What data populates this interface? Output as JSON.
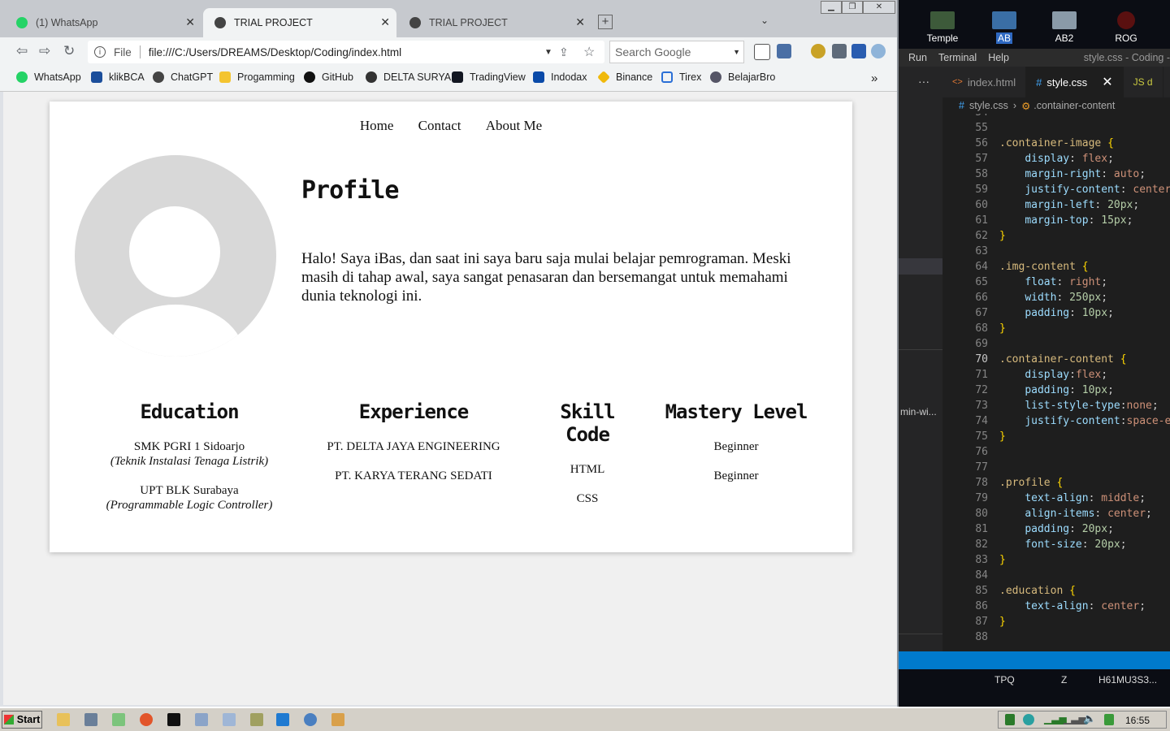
{
  "browser": {
    "tabs": [
      {
        "title": "(1) WhatsApp",
        "active": false
      },
      {
        "title": "TRIAL PROJECT",
        "active": true
      },
      {
        "title": "TRIAL PROJECT",
        "active": false
      }
    ],
    "address": {
      "scheme": "File",
      "url": "file:///C:/Users/DREAMS/Desktop/Coding/index.html"
    },
    "search_placeholder": "Search Google",
    "bookmarks": [
      "WhatsApp",
      "klikBCA",
      "ChatGPT",
      "Progamming",
      "GitHub",
      "DELTA SURYA",
      "TradingView",
      "Indodax",
      "Binance",
      "Tirex",
      "BelajarBro"
    ]
  },
  "page": {
    "nav": [
      "Home",
      "Contact",
      "About Me"
    ],
    "profile_title": "Profile",
    "profile_text": "Halo! Saya iBas, dan saat ini saya baru saja mulai belajar pemrograman. Meski masih di tahap awal, saya sangat penasaran dan bersemangat untuk memahami dunia teknologi ini.",
    "education": {
      "title": "Education",
      "items": [
        {
          "name": "SMK PGRI 1 Sidoarjo",
          "detail": "(Teknik Instalasi Tenaga Listrik)"
        },
        {
          "name": "UPT BLK Surabaya",
          "detail": "(Programmable Logic Controller)"
        }
      ]
    },
    "experience": {
      "title": "Experience",
      "items": [
        "PT. DELTA JAYA ENGINEERING",
        "PT. KARYA TERANG SEDATI"
      ]
    },
    "skills": {
      "title": "Skill Code",
      "items": [
        "HTML",
        "CSS"
      ]
    },
    "mastery": {
      "title": "Mastery Level",
      "items": [
        "Beginner",
        "Beginner"
      ]
    }
  },
  "desktop": {
    "icons": [
      "Temple",
      "AB",
      "AB2",
      "ROG"
    ]
  },
  "vscode": {
    "menu": [
      "Run",
      "Terminal",
      "Help"
    ],
    "window_title": "style.css - Coding -",
    "tabs": [
      {
        "label": "index.html",
        "active": false
      },
      {
        "label": "style.css",
        "active": true
      },
      {
        "label": "JS d",
        "active": false
      }
    ],
    "breadcrumb": {
      "file": "style.css",
      "symbol": ".container-content"
    },
    "side_label": "min-wi...",
    "current_line": "70",
    "bottom_items": [
      "TPQ",
      "Z",
      "H61MU3S3..."
    ]
  },
  "taskbar": {
    "start_label": "Start",
    "clock": "16:55"
  },
  "colors": {
    "vscode_accent": "#007acc",
    "css_selector": "#d7ba7d",
    "css_property": "#9cdcfe",
    "css_value": "#ce9178"
  }
}
